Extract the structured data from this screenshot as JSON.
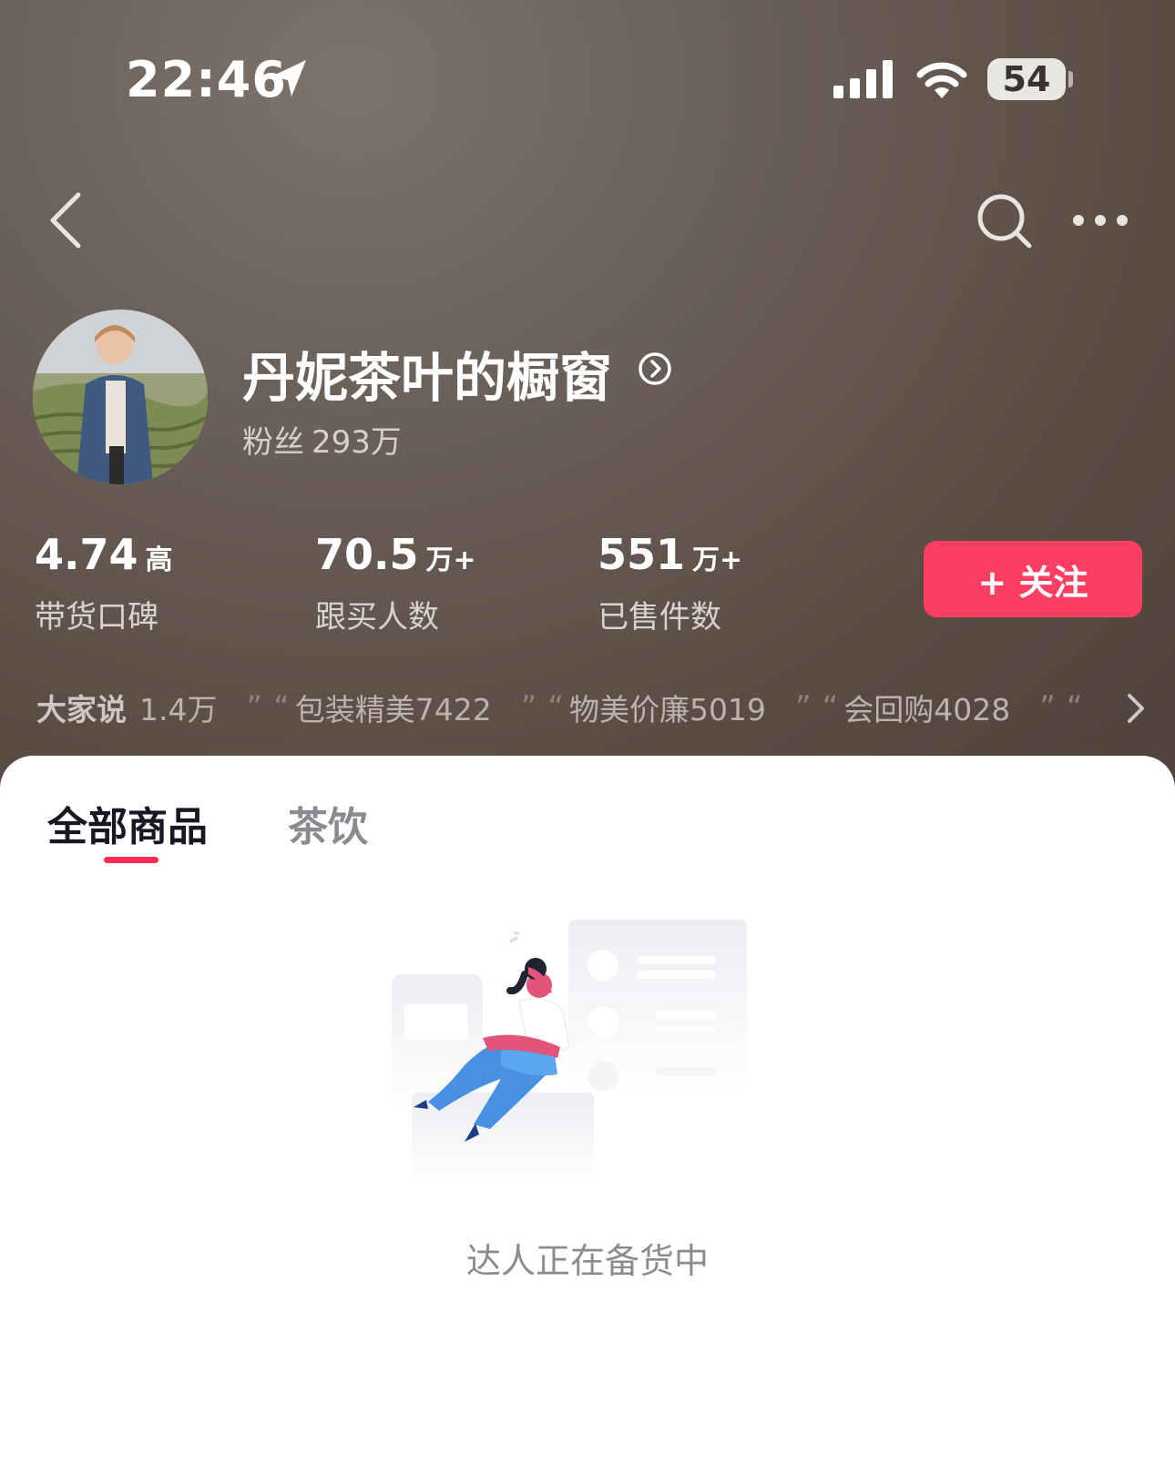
{
  "status_bar": {
    "time": "22:46",
    "battery": "54"
  },
  "nav": {
    "back_icon": "chevron-left-icon",
    "search_icon": "search-icon",
    "more_icon": "more-dots-icon"
  },
  "profile": {
    "shop_name": "丹妮茶叶的橱窗",
    "fans_label": "粉丝",
    "fans_value": "293万"
  },
  "stats": [
    {
      "value": "4.74",
      "unit": "高",
      "label": "带货口碑"
    },
    {
      "value": "70.5",
      "unit": "万+",
      "label": "跟买人数"
    },
    {
      "value": "551",
      "unit": "万+",
      "label": "已售件数"
    }
  ],
  "follow_button": "+ 关注",
  "reviews": {
    "heading": "大家说",
    "tags": [
      "1.4万",
      "包装精美7422",
      "物美价廉5019",
      "会回购4028"
    ]
  },
  "tabs": [
    {
      "label": "全部商品",
      "active": true
    },
    {
      "label": "茶饮",
      "active": false
    }
  ],
  "empty_state": {
    "message": "达人正在备货中"
  },
  "colors": {
    "accent": "#fe2c55",
    "follow_button": "#fe3d62",
    "header_bg": "#5e524a"
  }
}
